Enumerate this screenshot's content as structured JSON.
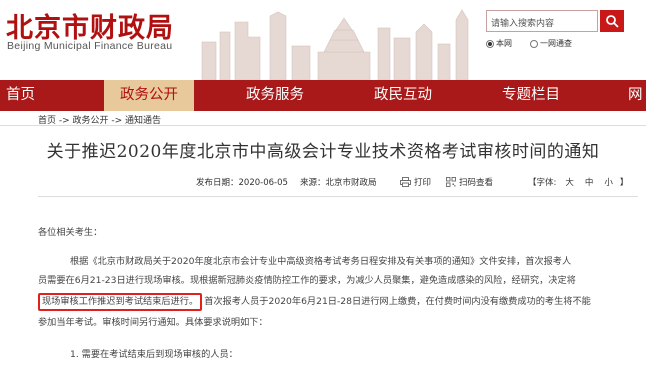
{
  "header": {
    "logo_cn": "北京市财政局",
    "logo_en": "Beijing Municipal Finance Bureau",
    "search_placeholder": "请输入搜索内容",
    "scope_site": "本网",
    "scope_all": "一网通查"
  },
  "nav": {
    "items": [
      "首页",
      "政务公开",
      "政务服务",
      "政民互动",
      "专题栏目",
      "网"
    ]
  },
  "breadcrumb": "首页 -> 政务公开 -> 通知通告",
  "article": {
    "title": "关于推迟2020年度北京市中高级会计专业技术资格考试审核时间的通知",
    "date": "发布日期：2020-06-05",
    "source": "来源：北京市财政局",
    "print": "打印",
    "share": "扫码查看",
    "font_label": "【字体:",
    "font_large": "大",
    "font_medium": "中",
    "font_small": "小",
    "font_close": "】",
    "greeting": "各位相关考生：",
    "para1_line1": "根据《北京市财政局关于2020年度北京市会计专业中高级资格考试考务日程安排及有关事项的通知》文件安排，首次报考人",
    "para1_line2": "员需要在6月21-23日进行现场审核。现根据新冠肺炎疫情防控工作的要求，为减少人员聚集，避免造成感染的风险，经研究，决定将",
    "para1_line3_highlight": "现场审核工作推迟到考试结束后进行。",
    "para1_line3_rest": "首次报考人员于2020年6月21日-28日进行网上缴费，在付费时间内没有缴费成功的考生将不能",
    "para1_line4": "参加当年考试。审核时间另行通知。具体要求说明如下：",
    "item1": "1. 需要在考试结束后到现场审核的人员："
  },
  "colors": {
    "brand_red": "#a91919",
    "nav_active_bg": "#e8c99b",
    "highlight_border": "#e02020"
  }
}
